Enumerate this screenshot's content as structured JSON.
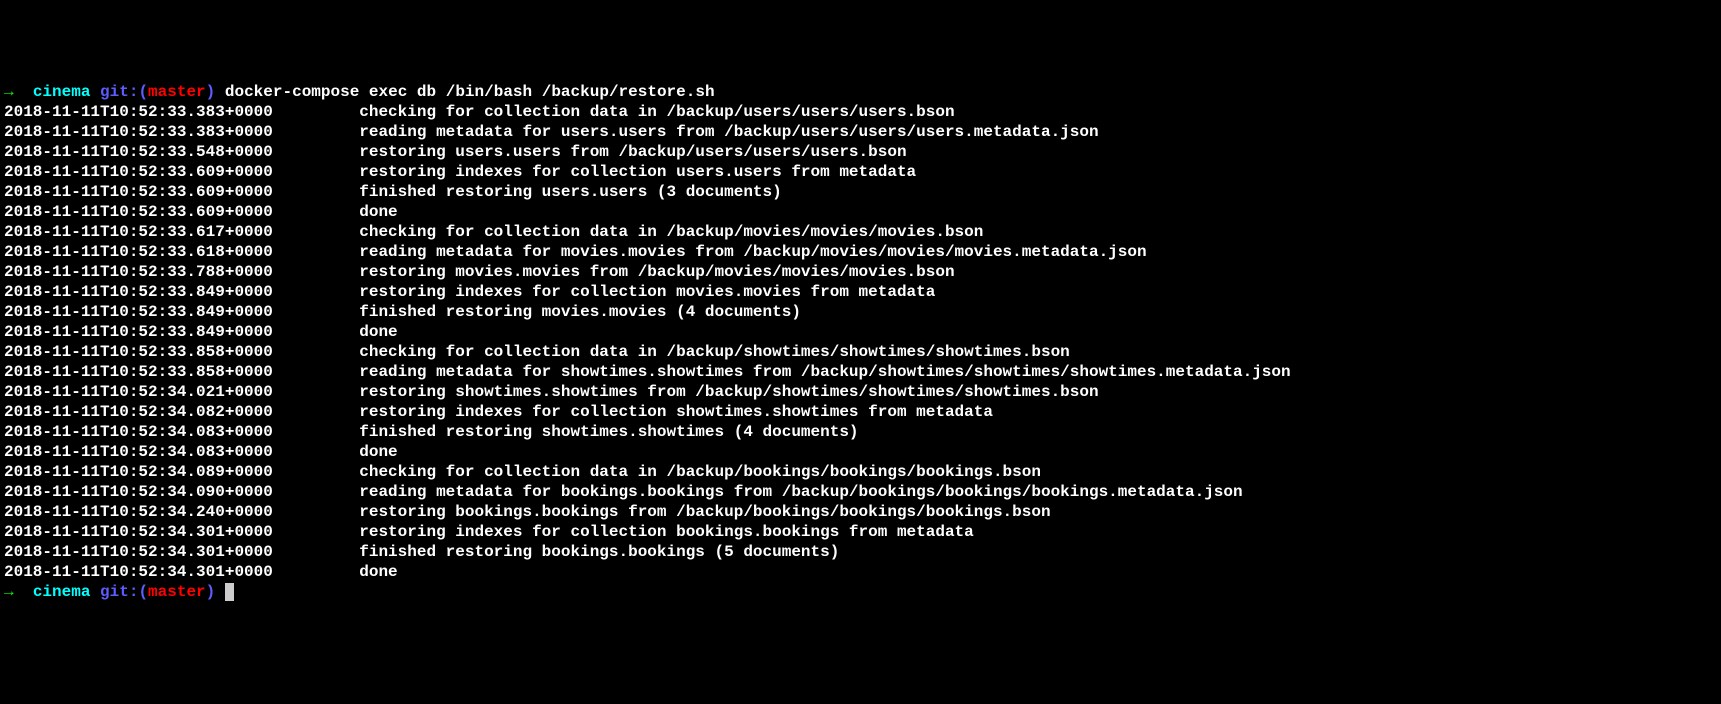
{
  "prompt1": {
    "arrow": "→",
    "dir": "cinema",
    "git_label": "git:(",
    "branch": "master",
    "git_close": ")",
    "command": "docker-compose exec db /bin/bash /backup/restore.sh"
  },
  "lines": [
    {
      "ts": "2018-11-11T10:52:33.383+0000",
      "msg": "checking for collection data in /backup/users/users/users.bson"
    },
    {
      "ts": "2018-11-11T10:52:33.383+0000",
      "msg": "reading metadata for users.users from /backup/users/users/users.metadata.json"
    },
    {
      "ts": "2018-11-11T10:52:33.548+0000",
      "msg": "restoring users.users from /backup/users/users/users.bson"
    },
    {
      "ts": "2018-11-11T10:52:33.609+0000",
      "msg": "restoring indexes for collection users.users from metadata"
    },
    {
      "ts": "2018-11-11T10:52:33.609+0000",
      "msg": "finished restoring users.users (3 documents)"
    },
    {
      "ts": "2018-11-11T10:52:33.609+0000",
      "msg": "done"
    },
    {
      "ts": "2018-11-11T10:52:33.617+0000",
      "msg": "checking for collection data in /backup/movies/movies/movies.bson"
    },
    {
      "ts": "2018-11-11T10:52:33.618+0000",
      "msg": "reading metadata for movies.movies from /backup/movies/movies/movies.metadata.json"
    },
    {
      "ts": "2018-11-11T10:52:33.788+0000",
      "msg": "restoring movies.movies from /backup/movies/movies/movies.bson"
    },
    {
      "ts": "2018-11-11T10:52:33.849+0000",
      "msg": "restoring indexes for collection movies.movies from metadata"
    },
    {
      "ts": "2018-11-11T10:52:33.849+0000",
      "msg": "finished restoring movies.movies (4 documents)"
    },
    {
      "ts": "2018-11-11T10:52:33.849+0000",
      "msg": "done"
    },
    {
      "ts": "2018-11-11T10:52:33.858+0000",
      "msg": "checking for collection data in /backup/showtimes/showtimes/showtimes.bson"
    },
    {
      "ts": "2018-11-11T10:52:33.858+0000",
      "msg": "reading metadata for showtimes.showtimes from /backup/showtimes/showtimes/showtimes.metadata.json"
    },
    {
      "ts": "2018-11-11T10:52:34.021+0000",
      "msg": "restoring showtimes.showtimes from /backup/showtimes/showtimes/showtimes.bson"
    },
    {
      "ts": "2018-11-11T10:52:34.082+0000",
      "msg": "restoring indexes for collection showtimes.showtimes from metadata"
    },
    {
      "ts": "2018-11-11T10:52:34.083+0000",
      "msg": "finished restoring showtimes.showtimes (4 documents)"
    },
    {
      "ts": "2018-11-11T10:52:34.083+0000",
      "msg": "done"
    },
    {
      "ts": "2018-11-11T10:52:34.089+0000",
      "msg": "checking for collection data in /backup/bookings/bookings/bookings.bson"
    },
    {
      "ts": "2018-11-11T10:52:34.090+0000",
      "msg": "reading metadata for bookings.bookings from /backup/bookings/bookings/bookings.metadata.json"
    },
    {
      "ts": "2018-11-11T10:52:34.240+0000",
      "msg": "restoring bookings.bookings from /backup/bookings/bookings/bookings.bson"
    },
    {
      "ts": "2018-11-11T10:52:34.301+0000",
      "msg": "restoring indexes for collection bookings.bookings from metadata"
    },
    {
      "ts": "2018-11-11T10:52:34.301+0000",
      "msg": "finished restoring bookings.bookings (5 documents)"
    },
    {
      "ts": "2018-11-11T10:52:34.301+0000",
      "msg": "done"
    }
  ],
  "prompt2": {
    "arrow": "→",
    "dir": "cinema",
    "git_label": "git:(",
    "branch": "master",
    "git_close": ")"
  }
}
